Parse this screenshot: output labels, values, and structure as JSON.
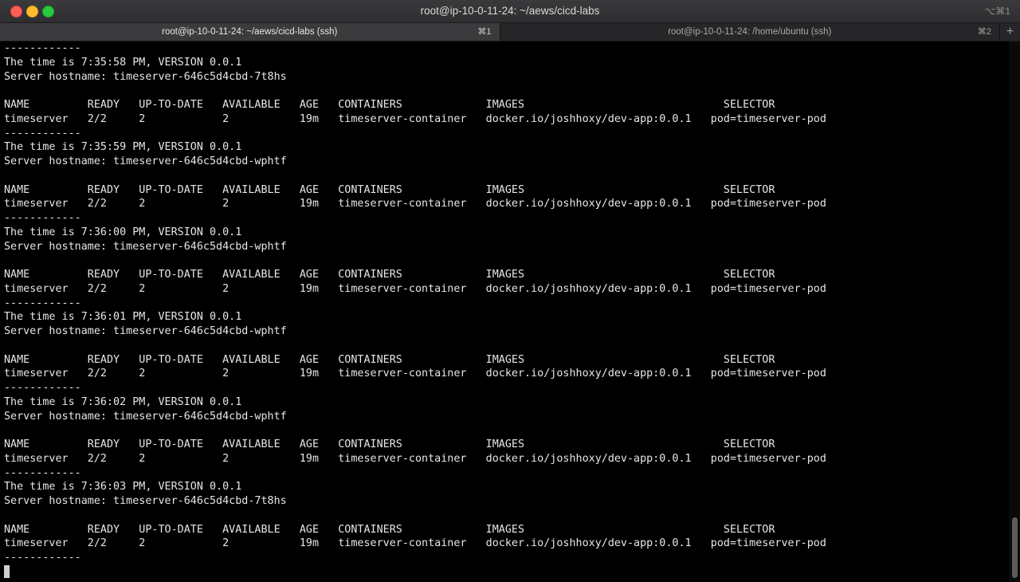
{
  "window": {
    "title": "root@ip-10-0-11-24: ~/aews/cicd-labs",
    "shortcut": "⌥⌘1"
  },
  "tabs": [
    {
      "label": "root@ip-10-0-11-24: ~/aews/cicd-labs (ssh)",
      "key": "⌘1",
      "active": true
    },
    {
      "label": "root@ip-10-0-11-24: /home/ubuntu (ssh)",
      "key": "⌘2",
      "active": false
    }
  ],
  "new_tab_label": "+",
  "terminal": {
    "lines": [
      "------------",
      "The time is 7:35:58 PM, VERSION 0.0.1",
      "Server hostname: timeserver-646c5d4cbd-7t8hs",
      "",
      "NAME         READY   UP-TO-DATE   AVAILABLE   AGE   CONTAINERS             IMAGES                               SELECTOR",
      "timeserver   2/2     2            2           19m   timeserver-container   docker.io/joshhoxy/dev-app:0.0.1   pod=timeserver-pod",
      "------------",
      "The time is 7:35:59 PM, VERSION 0.0.1",
      "Server hostname: timeserver-646c5d4cbd-wphtf",
      "",
      "NAME         READY   UP-TO-DATE   AVAILABLE   AGE   CONTAINERS             IMAGES                               SELECTOR",
      "timeserver   2/2     2            2           19m   timeserver-container   docker.io/joshhoxy/dev-app:0.0.1   pod=timeserver-pod",
      "------------",
      "The time is 7:36:00 PM, VERSION 0.0.1",
      "Server hostname: timeserver-646c5d4cbd-wphtf",
      "",
      "NAME         READY   UP-TO-DATE   AVAILABLE   AGE   CONTAINERS             IMAGES                               SELECTOR",
      "timeserver   2/2     2            2           19m   timeserver-container   docker.io/joshhoxy/dev-app:0.0.1   pod=timeserver-pod",
      "------------",
      "The time is 7:36:01 PM, VERSION 0.0.1",
      "Server hostname: timeserver-646c5d4cbd-wphtf",
      "",
      "NAME         READY   UP-TO-DATE   AVAILABLE   AGE   CONTAINERS             IMAGES                               SELECTOR",
      "timeserver   2/2     2            2           19m   timeserver-container   docker.io/joshhoxy/dev-app:0.0.1   pod=timeserver-pod",
      "------------",
      "The time is 7:36:02 PM, VERSION 0.0.1",
      "Server hostname: timeserver-646c5d4cbd-wphtf",
      "",
      "NAME         READY   UP-TO-DATE   AVAILABLE   AGE   CONTAINERS             IMAGES                               SELECTOR",
      "timeserver   2/2     2            2           19m   timeserver-container   docker.io/joshhoxy/dev-app:0.0.1   pod=timeserver-pod",
      "------------",
      "The time is 7:36:03 PM, VERSION 0.0.1",
      "Server hostname: timeserver-646c5d4cbd-7t8hs",
      "",
      "NAME         READY   UP-TO-DATE   AVAILABLE   AGE   CONTAINERS             IMAGES                               SELECTOR",
      "timeserver   2/2     2            2           19m   timeserver-container   docker.io/joshhoxy/dev-app:0.0.1   pod=timeserver-pod",
      "------------",
      ""
    ]
  },
  "colors": {
    "background": "#000000",
    "text": "#e6e6e6",
    "titlebar": "#38383a",
    "tab_active": "#3b3b3d",
    "tab_inactive": "#262628"
  }
}
